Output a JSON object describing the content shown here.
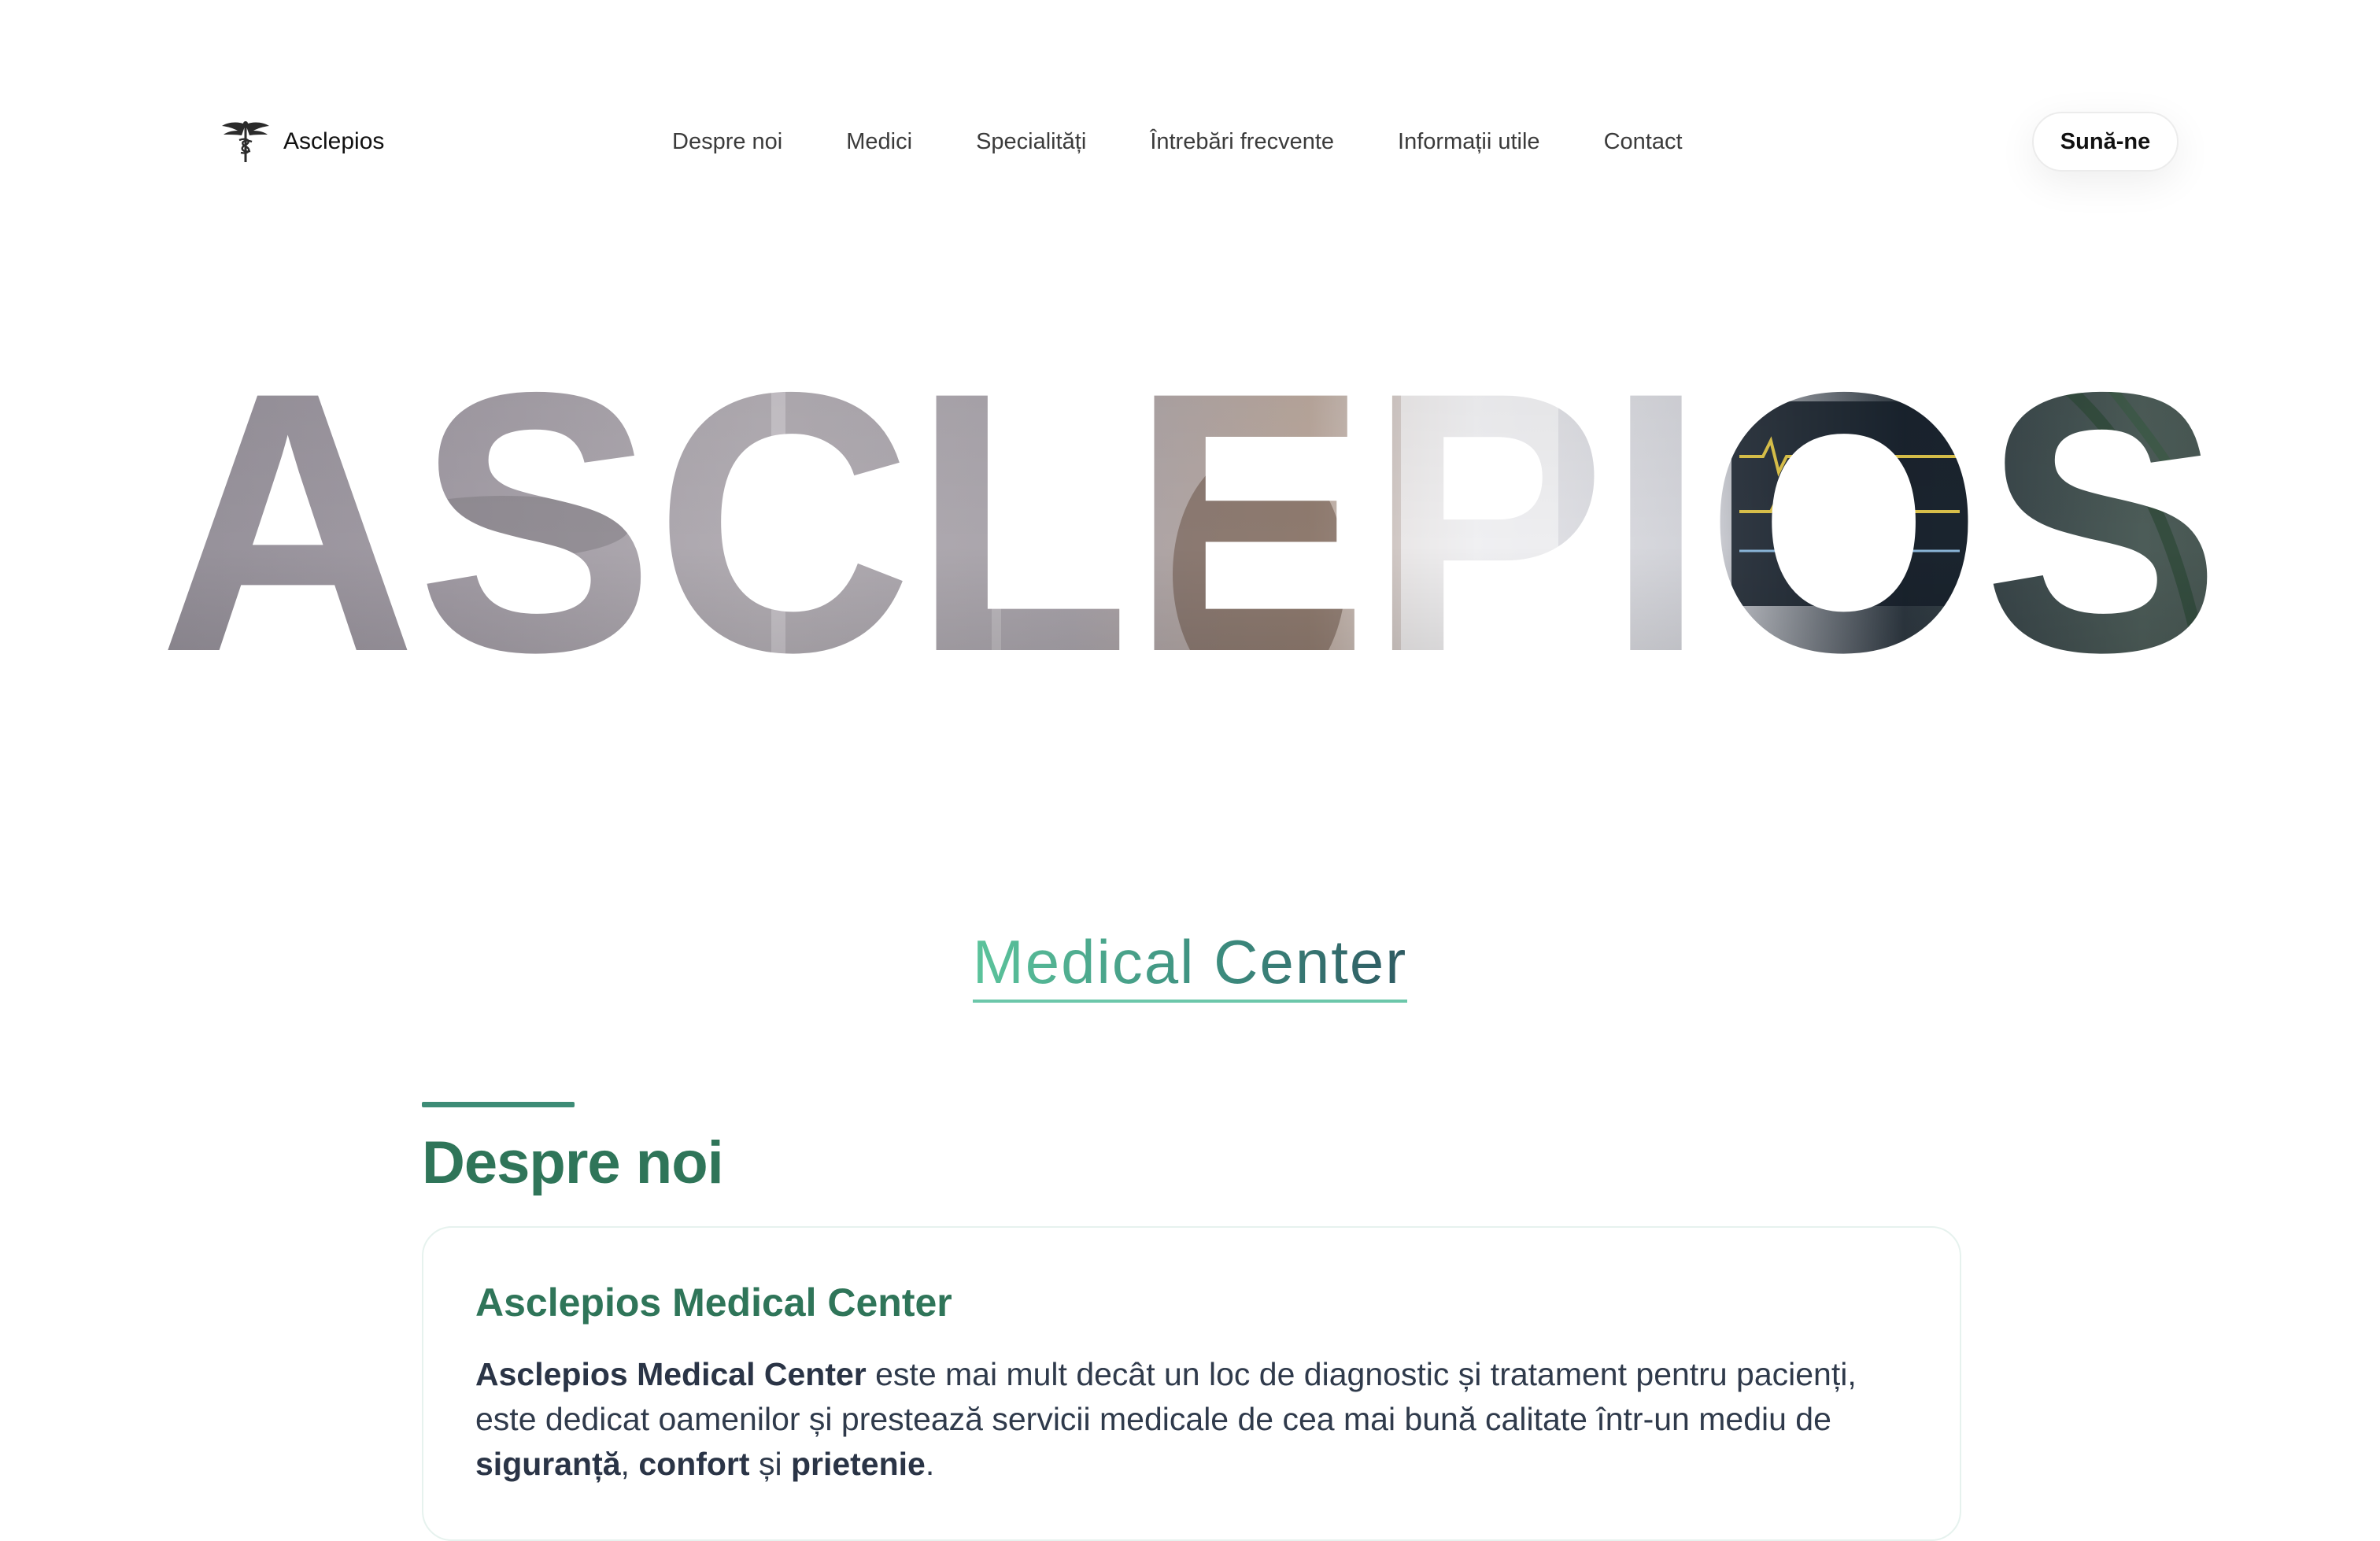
{
  "header": {
    "logo_text": "Asclepios",
    "logo_icon": "caduceus-icon",
    "nav": [
      {
        "label": "Despre noi"
      },
      {
        "label": "Medici"
      },
      {
        "label": "Specialități"
      },
      {
        "label": "Întrebări frecvente"
      },
      {
        "label": "Informații utile"
      },
      {
        "label": "Contact"
      }
    ],
    "cta_label": "Sună-ne"
  },
  "hero": {
    "word": "ASCLEPIOS"
  },
  "subtitle": "Medical Center",
  "about": {
    "heading": "Despre noi",
    "card_title": "Asclepios Medical Center",
    "p1_strong": "Asclepios Medical Center",
    "p1_text": " este mai mult decât un loc de diagnostic și tratament pentru pacienți, este dedicat oamenilor și prestează servicii medicale de cea mai bună calitate într-un mediu de ",
    "p1_k1": "siguranță",
    "p1_sep1": ", ",
    "p1_k2": "confort",
    "p1_sep2": " și ",
    "p1_k3": "prietenie",
    "p1_end": "."
  },
  "colors": {
    "accent": "#2f7559",
    "accent_light": "#5cc49c",
    "text": "#2f3a4b"
  }
}
